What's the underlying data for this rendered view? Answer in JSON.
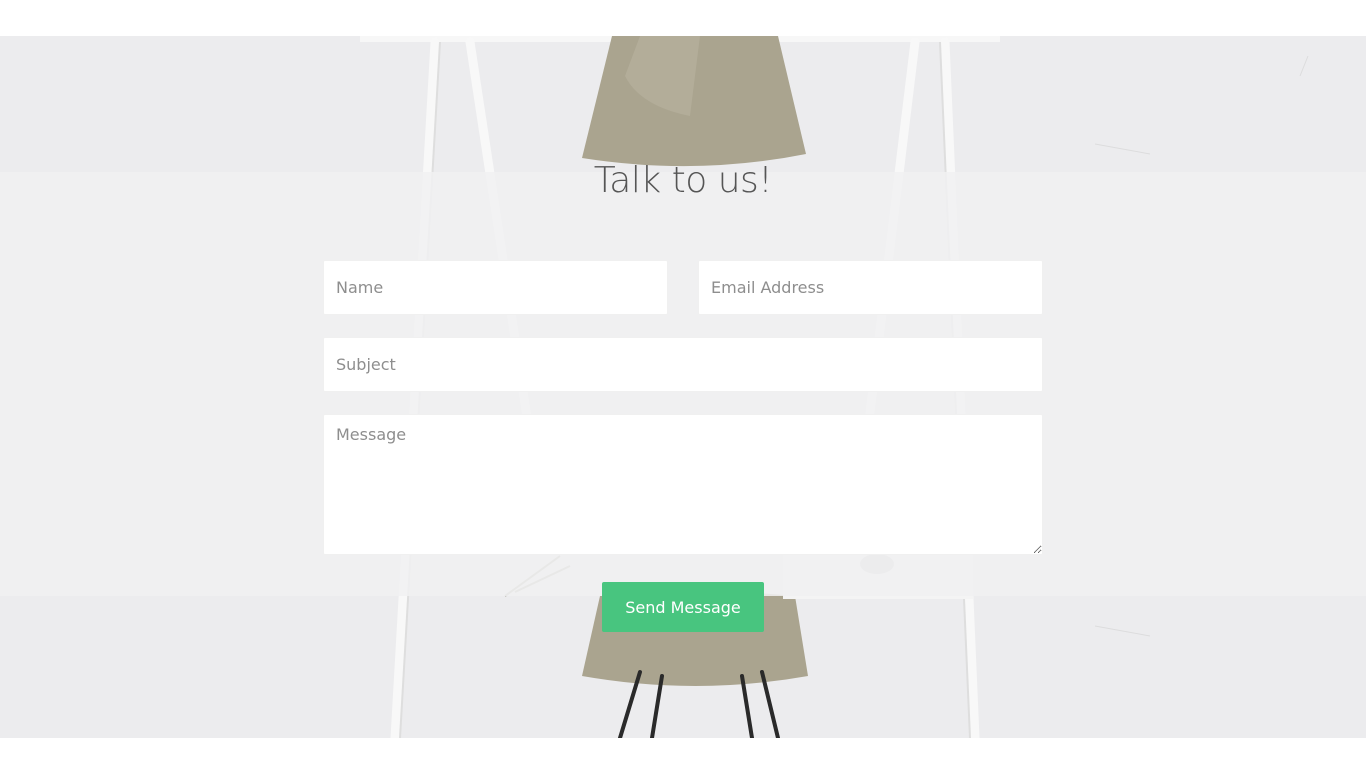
{
  "contact": {
    "title": "Talk to us!",
    "name_placeholder": "Name",
    "email_placeholder": "Email Address",
    "subject_placeholder": "Subject",
    "message_placeholder": "Message",
    "send_label": "Send Message"
  },
  "colors": {
    "accent_button": "#48c57f",
    "section_background": "#ececee",
    "title_text": "#555555",
    "placeholder_text": "#8e8e8e"
  },
  "icons": {
    "background_image": "desk-and-chair-photo"
  }
}
